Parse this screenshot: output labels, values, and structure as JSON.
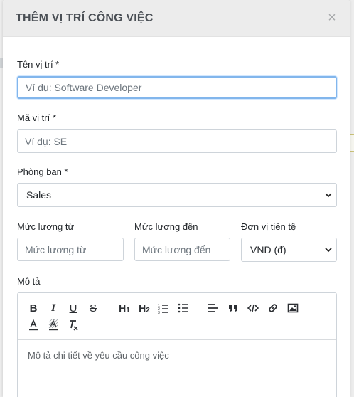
{
  "modal": {
    "title": "THÊM VỊ TRÍ CÔNG VIỆC",
    "close_symbol": "×"
  },
  "fields": {
    "position_name": {
      "label": "Tên vị trí *",
      "placeholder": "Ví dụ: Software Developer"
    },
    "position_code": {
      "label": "Mã vị trí *",
      "placeholder": "Ví dụ: SE"
    },
    "department": {
      "label": "Phòng ban *",
      "selected": "Sales"
    },
    "salary_from": {
      "label": "Mức lương từ",
      "placeholder": "Mức lương từ"
    },
    "salary_to": {
      "label": "Mức lương đến",
      "placeholder": "Mức lương đến"
    },
    "currency": {
      "label": "Đơn vị tiền tệ",
      "selected": "VND (đ)"
    },
    "description": {
      "label": "Mô tả",
      "placeholder": "Mô tả chi tiết về yêu cầu công việc"
    }
  },
  "toolbar": {
    "bold": "B",
    "italic": "I",
    "underline": "U",
    "strike": "S",
    "h1": "H1",
    "h2": "H2"
  }
}
